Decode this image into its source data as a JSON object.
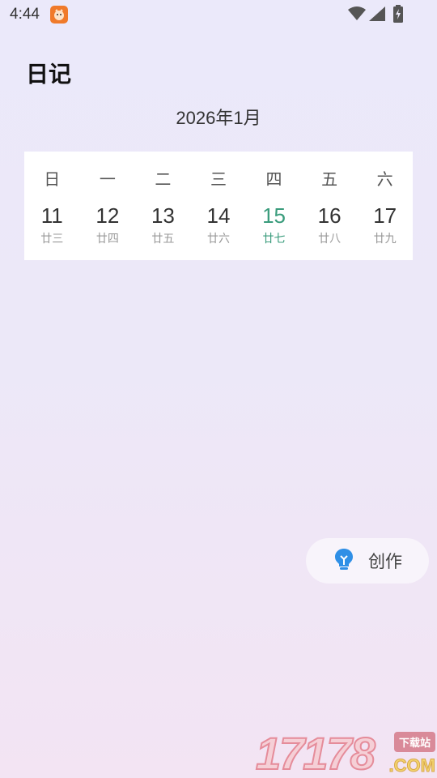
{
  "status_bar": {
    "time": "4:44",
    "icons": [
      "app-notification-icon",
      "wifi-icon",
      "signal-icon",
      "battery-icon"
    ]
  },
  "header": {
    "title": "日记",
    "month": "2026年1月"
  },
  "week": {
    "weekdays": [
      "日",
      "一",
      "二",
      "三",
      "四",
      "五",
      "六"
    ],
    "dates": [
      "11",
      "12",
      "13",
      "14",
      "15",
      "16",
      "17"
    ],
    "lunar": [
      "廿三",
      "廿四",
      "廿五",
      "廿六",
      "廿七",
      "廿八",
      "廿九"
    ],
    "today_index": 4,
    "today_color": "#3a9c7c"
  },
  "fab": {
    "label": "创作",
    "icon": "lightbulb-icon",
    "icon_color": "#2f8fe6"
  },
  "watermark": {
    "number": "17178",
    "tag": "下载站",
    "suffix": ".COM"
  }
}
